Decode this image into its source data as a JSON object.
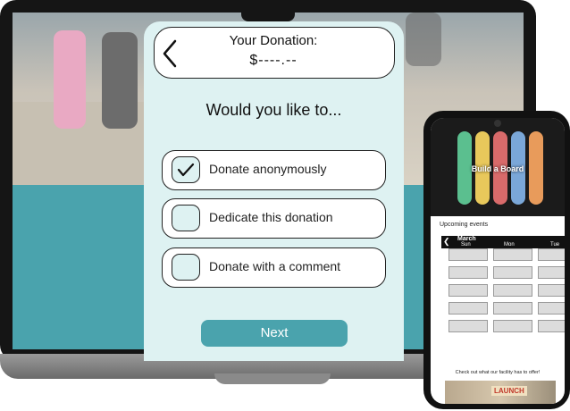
{
  "donation": {
    "title": "Your Donation:",
    "amount": "$----.--",
    "question": "Would you like to...",
    "options": [
      {
        "label": "Donate anonymously",
        "checked": true
      },
      {
        "label": "Dedicate this donation",
        "checked": false
      },
      {
        "label": "Donate with a comment",
        "checked": false
      }
    ],
    "next_label": "Next",
    "accent_color": "#4aa3ad",
    "panel_color": "#def2f2"
  },
  "phone": {
    "hero_title": "Build a Board",
    "events_label": "Upcoming events",
    "calendar": {
      "month": "March",
      "days": [
        "Sun",
        "Mon",
        "Tue"
      ]
    },
    "footer_text": "Check out what our facility has to offer!",
    "footer_logo": "LAUNCH"
  },
  "icons": {
    "back": "chevron-left-icon",
    "check": "checkmark-icon"
  }
}
